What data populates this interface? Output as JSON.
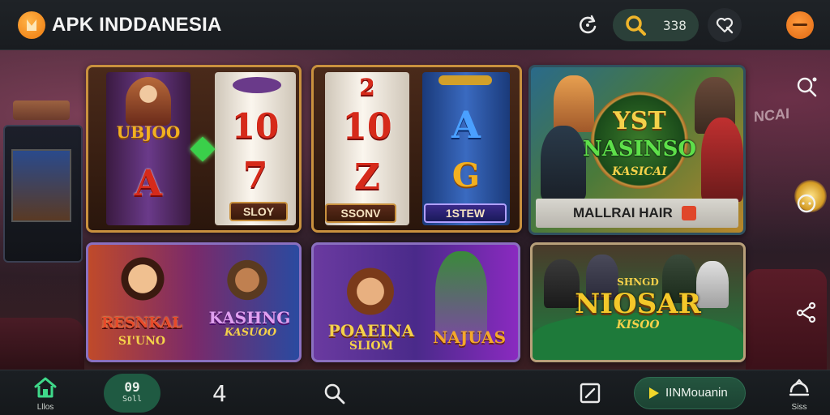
{
  "app": {
    "title": "APK INDDANESIA"
  },
  "topbar": {
    "refresh_icon": "refresh-icon",
    "search_count": "338",
    "favorite_icon": "heart-search-icon",
    "avatar_icon": "avatar-icon"
  },
  "tiles": [
    {
      "reel_top_text": "UBJOO",
      "symbols": [
        "A",
        "10",
        "7"
      ],
      "label": "SLOY"
    },
    {
      "symbols_left": [
        "2",
        "10",
        "Z"
      ],
      "label_left": "SSONV",
      "symbols_right": [
        "A",
        "G"
      ],
      "label_right": "1STEW"
    },
    {
      "title_line1": "YST",
      "title_line2": "NASINSO",
      "title_line3": "KASICAI",
      "banner": "MALLRAI HAIR"
    },
    {
      "title_line1": "RESNKAL",
      "title_line2": "SI'UNO",
      "title_right1": "KASHNG",
      "title_right2": "KASUOO"
    },
    {
      "title_line1": "POAEINA",
      "title_line2": "SLIOM",
      "title_right": "NAJUAS"
    },
    {
      "title_top": "SHNGD",
      "title_line1": "NIOSAR",
      "title_line2": "KISOO"
    }
  ],
  "background": {
    "sign_right": "NCAI"
  },
  "side_actions": {
    "search_icon": "search-icon",
    "chat_icon": "chat-icon",
    "share_icon": "share-icon"
  },
  "bottombar": {
    "home_label": "Lllos",
    "pill_number": "09",
    "pill_sub": "Soll",
    "four_label": "4",
    "cta_label": "IINMouanin",
    "user_label": "Siss"
  },
  "colors": {
    "accent_green": "#1f5a42",
    "gold_border": "#c9913e",
    "orange_logo": "#f28a1e"
  }
}
